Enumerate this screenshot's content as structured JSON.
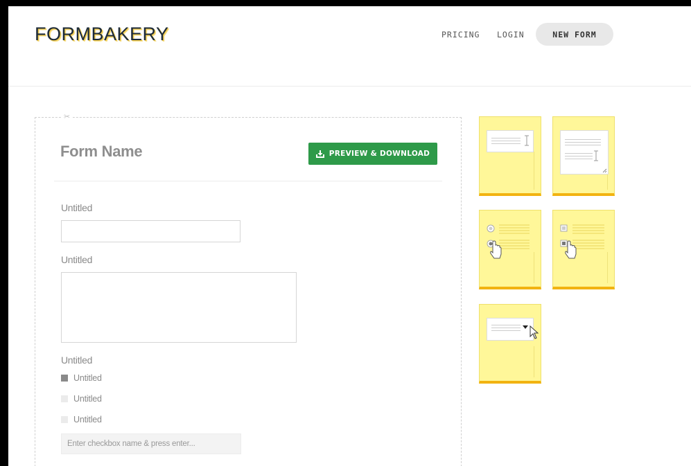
{
  "header": {
    "logo": "FORMBAKERY",
    "nav": {
      "pricing": "PRICING",
      "login": "LOGIN",
      "new_form": "NEW FORM"
    }
  },
  "form": {
    "name": "Form Name",
    "preview_button": "PREVIEW & DOWNLOAD",
    "fields": {
      "text_label": "Untitled",
      "textarea_label": "Untitled",
      "checkbox_group_label": "Untitled",
      "checkboxes": [
        {
          "label": "Untitled",
          "checked": true
        },
        {
          "label": "Untitled",
          "checked": false
        },
        {
          "label": "Untitled",
          "checked": false
        }
      ],
      "checkbox_add_placeholder": "Enter checkbox name & press enter..."
    }
  },
  "palette": {
    "widgets": [
      {
        "name": "text-field-widget",
        "icon": "text-input-icon"
      },
      {
        "name": "textarea-widget",
        "icon": "textarea-icon"
      },
      {
        "name": "radio-widget",
        "icon": "radio-icon"
      },
      {
        "name": "checkbox-widget",
        "icon": "checkbox-icon"
      },
      {
        "name": "dropdown-widget",
        "icon": "dropdown-icon"
      }
    ],
    "colors": {
      "sticky": "#fff799",
      "sticky_edge": "#f2b311"
    }
  },
  "colors": {
    "accent": "#2e9a49"
  }
}
